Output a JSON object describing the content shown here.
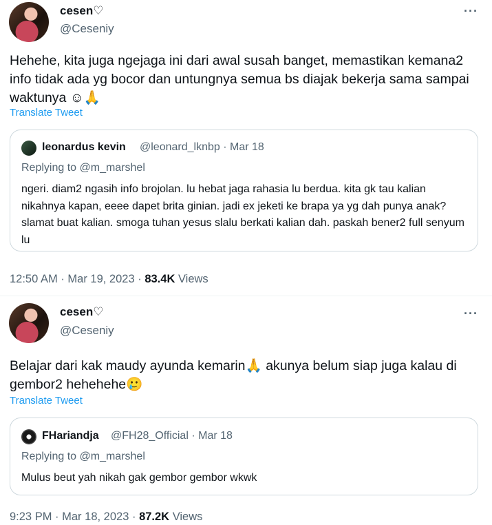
{
  "tweets": [
    {
      "name": "cesen♡",
      "handle": "@Ceseniy",
      "more": "···",
      "text": "Hehehe, kita juga ngejaga ini dari awal susah banget, memastikan kemana2 info tidak ada yg bocor dan untungnya semua bs diajak bekerja sama sampai waktunya ☺🙏",
      "translate": "Translate Tweet",
      "quote": {
        "name": "leonardus kevin",
        "handle": "@leonard_lknbp",
        "date": "Mar 18",
        "replying_prefix": "Replying to",
        "replying_to": "@m_marshel",
        "text": "ngeri. diam2 ngasih info brojolan. lu hebat jaga rahasia lu berdua. kita gk tau kalian nikahnya kapan, eeee dapet brita ginian. jadi ex jeketi ke brapa ya yg dah punya anak? slamat buat kalian. smoga tuhan yesus slalu berkati kalian dah. paskah bener2 full senyum lu"
      },
      "time": "12:50 AM",
      "date": "Mar 19, 2023",
      "views": "83.4K",
      "views_label": "Views"
    },
    {
      "name": "cesen♡",
      "handle": "@Ceseniy",
      "more": "···",
      "text": "Belajar dari kak maudy ayunda kemarin🙏 akunya belum siap juga kalau di gembor2 hehehehe🥲",
      "translate": "Translate Tweet",
      "quote": {
        "name": "FHariandja",
        "handle": "@FH28_Official",
        "date": "Mar 18",
        "replying_prefix": "Replying to",
        "replying_to": "@m_marshel",
        "text": "Mulus beut yah nikah gak gembor gembor wkwk"
      },
      "time": "9:23 PM",
      "date": "Mar 18, 2023",
      "views": "87.2K",
      "views_label": "Views"
    }
  ]
}
